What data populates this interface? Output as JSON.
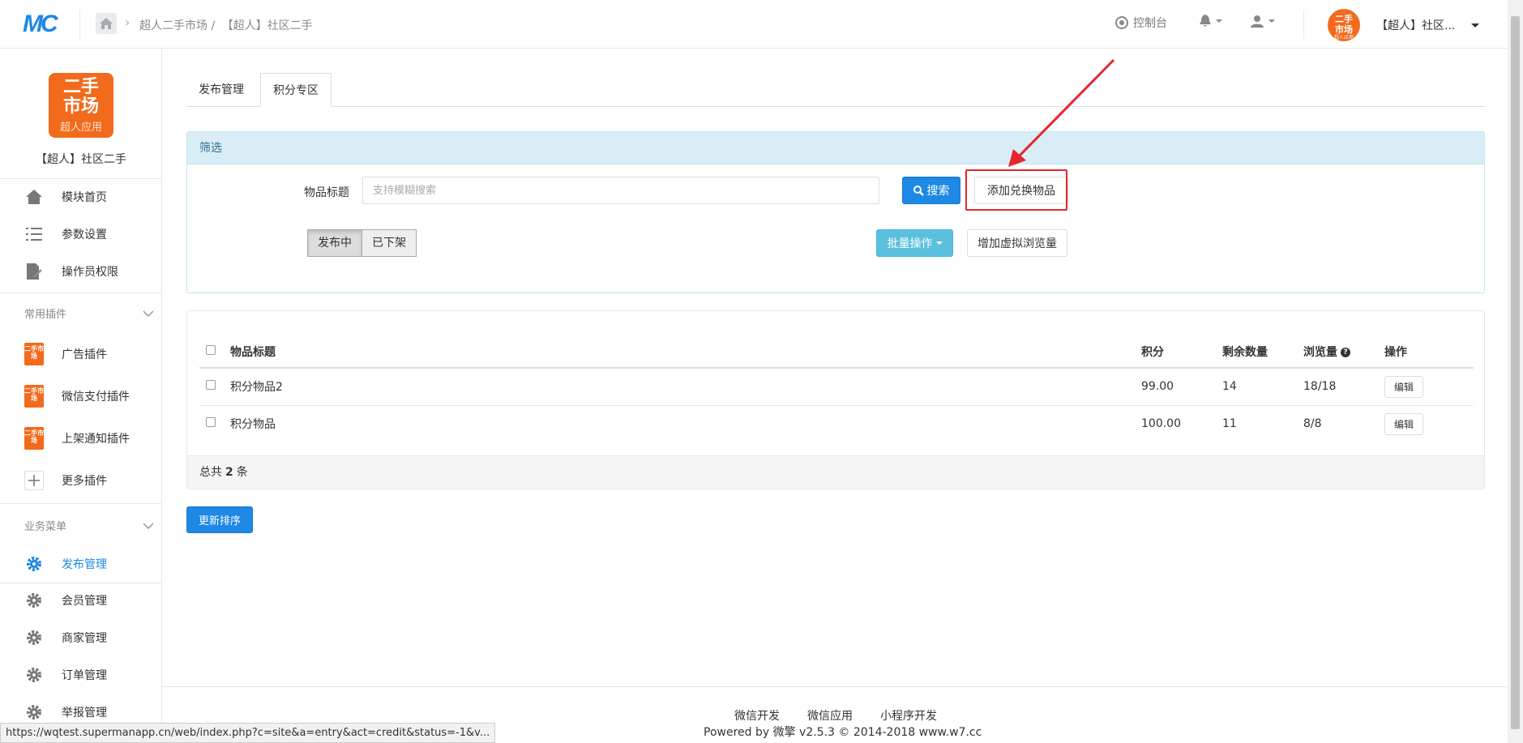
{
  "header": {
    "logo_text": "MC",
    "breadcrumb": [
      "超人二手市场 /",
      "【超人】社区二手"
    ],
    "console_label": "控制台",
    "avatar_text": "二手市场",
    "avatar_sub": "超人应用",
    "account_name": "【超人】社区..."
  },
  "sidebar": {
    "app_logo_line1": "二手",
    "app_logo_line2": "市场",
    "app_logo_sub": "超人应用",
    "app_name": "【超人】社区二手",
    "main_items": [
      {
        "label": "模块首页",
        "icon": "home-icon"
      },
      {
        "label": "参数设置",
        "icon": "list-icon"
      },
      {
        "label": "操作员权限",
        "icon": "doc-edit-icon"
      }
    ],
    "plugins_header": "常用插件",
    "plugin_icon_text": "二手市场",
    "plugins": [
      {
        "label": "广告插件"
      },
      {
        "label": "微信支付插件"
      },
      {
        "label": "上架通知插件"
      },
      {
        "label": "更多插件"
      }
    ],
    "business_header": "业务菜单",
    "business_items": [
      {
        "label": "发布管理",
        "active": true
      },
      {
        "label": "会员管理"
      },
      {
        "label": "商家管理"
      },
      {
        "label": "订单管理"
      },
      {
        "label": "举报管理"
      }
    ]
  },
  "tabs": [
    "发布管理",
    "积分专区"
  ],
  "filter": {
    "title": "筛选",
    "field_label": "物品标题",
    "placeholder": "支持模糊搜索",
    "search_button": "搜索",
    "add_button": "添加兑换物品",
    "status_options": [
      "发布中",
      "已下架"
    ],
    "batch_button": "批量操作",
    "virtual_views_button": "增加虚拟浏览量"
  },
  "table": {
    "columns": [
      "物品标题",
      "积分",
      "剩余数量",
      "浏览量",
      "操作"
    ],
    "rows": [
      {
        "title": "积分物品2",
        "points": "99.00",
        "remaining": "14",
        "views": "18/18",
        "action": "编辑"
      },
      {
        "title": "积分物品",
        "points": "100.00",
        "remaining": "11",
        "views": "8/8",
        "action": "编辑"
      }
    ],
    "total_prefix": "总共",
    "total_count": "2",
    "total_suffix": "条"
  },
  "update_sort_button": "更新排序",
  "footer": {
    "links": [
      "微信开发",
      "微信应用",
      "小程序开发"
    ],
    "copyright": "Powered by 微擎 v2.5.3 © 2014-2018 www.w7.cc"
  },
  "status_url": "https://wqtest.supermanapp.cn/web/index.php?c=site&a=entry&act=credit&status=-1&v...",
  "colors": {
    "primary": "#1e88e5",
    "info": "#5bc0de",
    "brand_orange": "#f26a1b",
    "highlight_red": "#e5262b"
  }
}
